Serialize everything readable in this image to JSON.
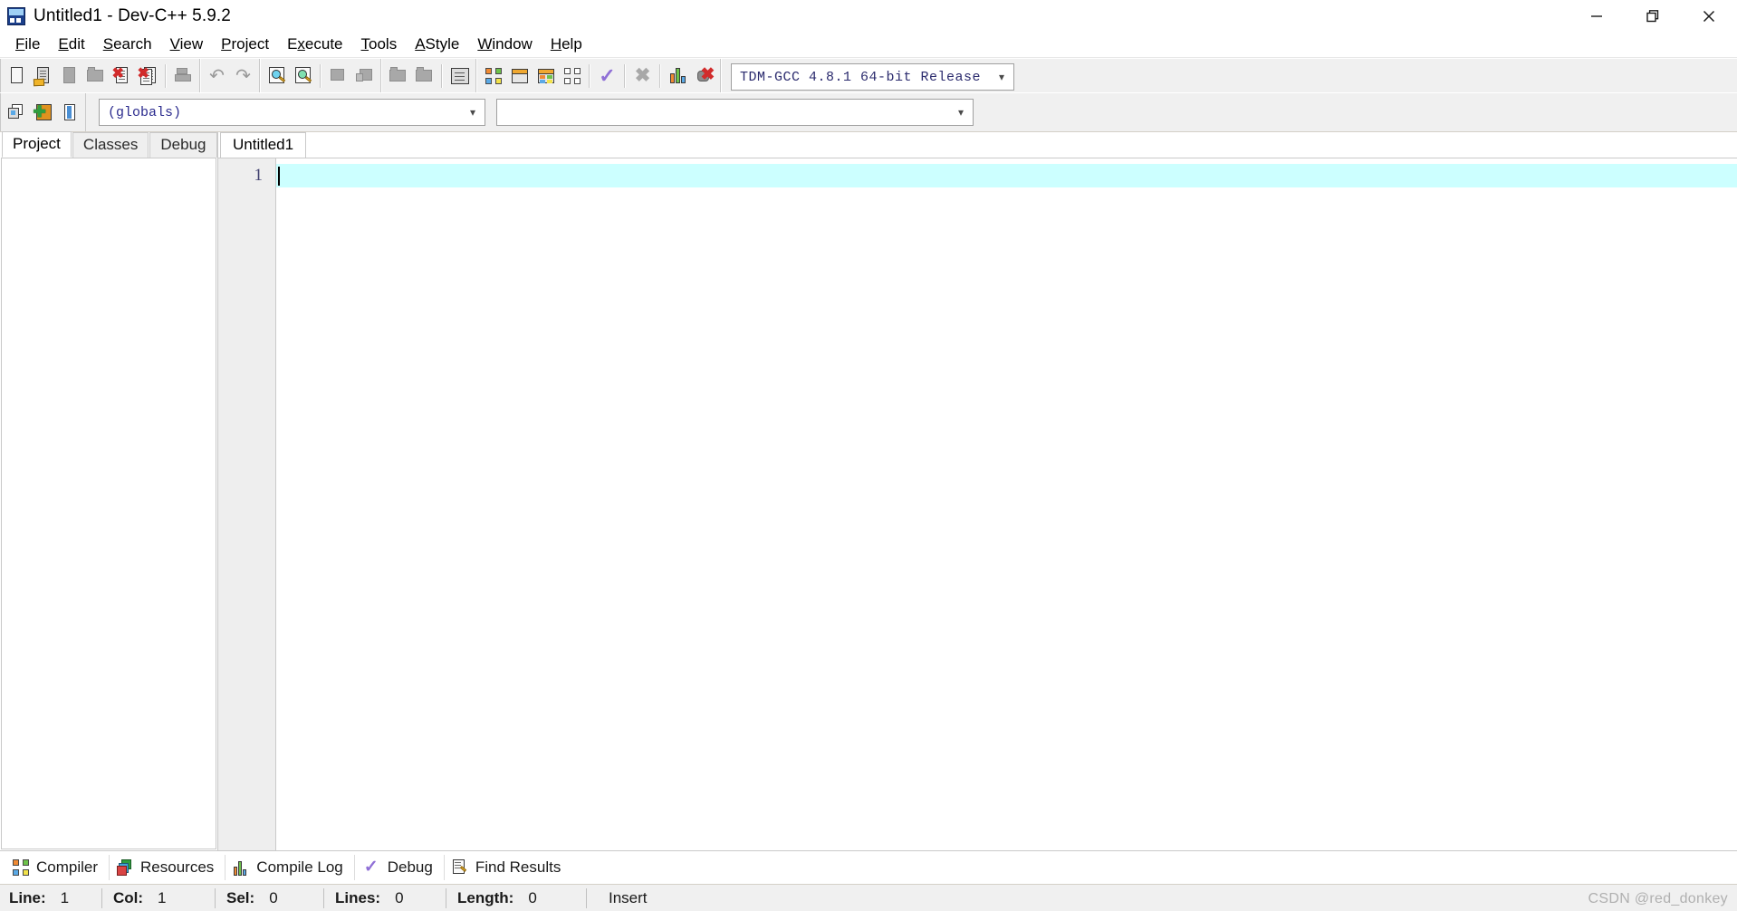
{
  "window": {
    "title": "Untitled1 - Dev-C++ 5.9.2",
    "app_icon": "devcpp-app-icon",
    "minimize_label": "—",
    "restore_label": "restore",
    "close_label": "✕"
  },
  "menubar": {
    "items": [
      {
        "label": "File",
        "accel": "F",
        "pre": "",
        "post": "ile"
      },
      {
        "label": "Edit",
        "accel": "E",
        "pre": "",
        "post": "dit"
      },
      {
        "label": "Search",
        "accel": "S",
        "pre": "",
        "post": "earch"
      },
      {
        "label": "View",
        "accel": "V",
        "pre": "",
        "post": "iew"
      },
      {
        "label": "Project",
        "accel": "P",
        "pre": "",
        "post": "roject"
      },
      {
        "label": "Execute",
        "accel": "x",
        "pre": "E",
        "post": "ecute"
      },
      {
        "label": "Tools",
        "accel": "T",
        "pre": "",
        "post": "ools"
      },
      {
        "label": "AStyle",
        "accel": "A",
        "pre": "",
        "post": "Style"
      },
      {
        "label": "Window",
        "accel": "W",
        "pre": "",
        "post": "indow"
      },
      {
        "label": "Help",
        "accel": "H",
        "pre": "",
        "post": "elp"
      }
    ]
  },
  "toolbar": {
    "buttons": [
      {
        "name": "new-file",
        "icon": "new-page-icon"
      },
      {
        "name": "open-file",
        "icon": "open-folder-page-icon"
      },
      {
        "name": "save-file",
        "icon": "save-icon"
      },
      {
        "name": "save-all",
        "icon": "save-all-icon"
      },
      {
        "name": "close-file",
        "icon": "close-page-icon"
      },
      {
        "name": "close-all",
        "icon": "close-all-pages-icon"
      },
      {
        "name": "print",
        "icon": "printer-icon"
      },
      {
        "name": "undo",
        "icon": "undo-arrow-icon"
      },
      {
        "name": "redo",
        "icon": "redo-arrow-icon"
      },
      {
        "name": "find",
        "icon": "find-magnifier-icon"
      },
      {
        "name": "replace",
        "icon": "replace-magnifier-icon"
      },
      {
        "name": "cut",
        "icon": "cut-icon"
      },
      {
        "name": "copy",
        "icon": "copy-icon"
      },
      {
        "name": "goto-previous",
        "icon": "goto-prev-icon"
      },
      {
        "name": "goto-next",
        "icon": "goto-next-icon"
      },
      {
        "name": "toggle-bookmark",
        "icon": "lines-icon"
      },
      {
        "name": "compile",
        "icon": "compile-squares-icon"
      },
      {
        "name": "run",
        "icon": "run-window-icon"
      },
      {
        "name": "compile-and-run",
        "icon": "compile-run-icon"
      },
      {
        "name": "rebuild-all",
        "icon": "rebuild-squares-icon"
      },
      {
        "name": "syntax-check",
        "icon": "check-icon"
      },
      {
        "name": "stop-execution",
        "icon": "stop-x-icon"
      },
      {
        "name": "profile",
        "icon": "profile-bars-icon"
      },
      {
        "name": "delete-profile",
        "icon": "delete-profile-icon"
      }
    ],
    "compiler_combo": {
      "value": "TDM-GCC 4.8.1 64-bit Release",
      "caret": "⌄"
    }
  },
  "toolbar2": {
    "buttons": [
      {
        "name": "goto-class-browser",
        "icon": "goto-window-icon"
      },
      {
        "name": "add-to-project",
        "icon": "add-orange-box-icon"
      },
      {
        "name": "toggle-panel",
        "icon": "book-panel-icon"
      }
    ],
    "scope_combo": {
      "value": "(globals)",
      "caret": "⌄"
    },
    "member_combo": {
      "value": "",
      "caret": "⌄"
    }
  },
  "left_panel": {
    "tabs": [
      {
        "label": "Project",
        "active": true
      },
      {
        "label": "Classes",
        "active": false
      },
      {
        "label": "Debug",
        "active": false
      }
    ],
    "content": ""
  },
  "editor": {
    "tabs": [
      {
        "label": "Untitled1",
        "active": true
      }
    ],
    "lines": [
      {
        "number": "1",
        "text": ""
      }
    ],
    "caret_visible": true
  },
  "bottom_panel": {
    "tabs": [
      {
        "label": "Compiler",
        "icon": "compiler-squares-icon"
      },
      {
        "label": "Resources",
        "icon": "resources-stack-icon"
      },
      {
        "label": "Compile Log",
        "icon": "compile-log-bars-icon"
      },
      {
        "label": "Debug",
        "icon": "debug-check-icon"
      },
      {
        "label": "Find Results",
        "icon": "find-results-icon"
      }
    ]
  },
  "statusbar": {
    "fields": [
      {
        "label": "Line:",
        "value": "1"
      },
      {
        "label": "Col:",
        "value": "1"
      },
      {
        "label": "Sel:",
        "value": "0"
      },
      {
        "label": "Lines:",
        "value": "0"
      },
      {
        "label": "Length:",
        "value": "0"
      }
    ],
    "mode": "Insert",
    "watermark": "CSDN @red_donkey"
  },
  "colors": {
    "toolbar_bg": "#f0f0f0",
    "active_line": "#ccffff",
    "gutter_bg": "#eeeeee",
    "accent_orange": "#f08a33",
    "accent_green": "#6dc24a",
    "accent_blue": "#5aa9e6",
    "accent_yellow": "#f2e24a",
    "accent_red": "#d12b2b",
    "check_purple": "#8f6fd6"
  }
}
